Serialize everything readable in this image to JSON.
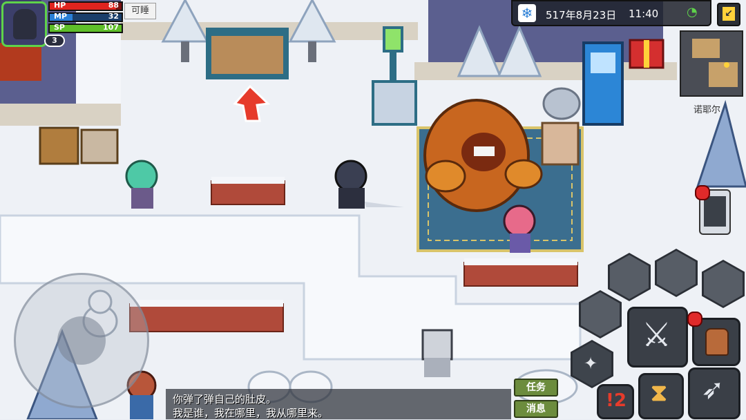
{
  "hud": {
    "hp_label": "HP",
    "hp_value": "88",
    "mp_label": "MP",
    "mp_value": "32",
    "sp_label": "SP",
    "sp_value": "107",
    "level": "3",
    "status_badge": "可睡"
  },
  "topbar": {
    "weather_icon": "snowflake-icon",
    "date": "517年8月23日",
    "time": "11:40",
    "wifi_icon": "wifi-icon",
    "exit_icon": "exit-icon"
  },
  "minimap": {
    "location": "诺耶尔"
  },
  "dialog": {
    "line1": "你弹了弹自己的肚皮。",
    "line2": "我是谁，我在哪里，我从哪里来。"
  },
  "buttons": {
    "quest": "任务",
    "message": "消息"
  },
  "skills": {
    "attack_icon": "sword-icon",
    "bag_icon": "backpack-icon",
    "wait_icon": "hourglass-icon",
    "bow_icon": "bow-icon",
    "dodge_icon": "shuriken-icon",
    "alert_text": "!2"
  },
  "colors": {
    "hp": "#e0241f",
    "mp": "#2a7fd6",
    "sp": "#5fbf2a",
    "snow": "#eef1f6",
    "rug": "#3b6e8f"
  }
}
